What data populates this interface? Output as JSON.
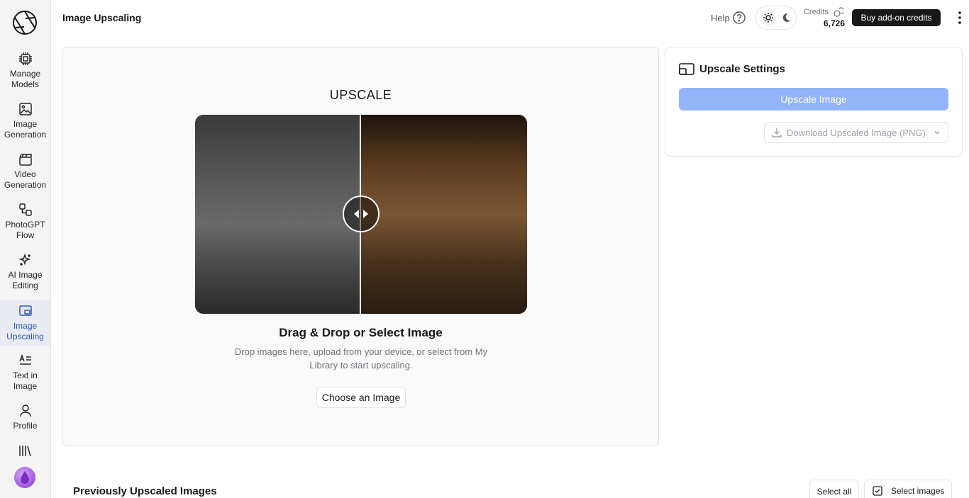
{
  "app": {
    "page_title": "Image Upscaling"
  },
  "sidebar": {
    "items": [
      {
        "label": "Manage Models",
        "icon": "chip-icon"
      },
      {
        "label": "Image Generation",
        "icon": "image-icon"
      },
      {
        "label": "Video Generation",
        "icon": "clapperboard-icon"
      },
      {
        "label": "PhotoGPT Flow",
        "icon": "workflow-icon"
      },
      {
        "label": "AI Image Editing",
        "icon": "sparkles-icon"
      },
      {
        "label": "Image Upscaling",
        "icon": "upscale-icon",
        "active": true
      },
      {
        "label": "Text in Image",
        "icon": "text-icon"
      },
      {
        "label": "Profile",
        "icon": "user-icon"
      }
    ]
  },
  "header": {
    "help_label": "Help",
    "credits_label": "Credits",
    "credits_value": "6,726",
    "buy_label": "Buy add-on credits"
  },
  "upload": {
    "heading": "UPSCALE",
    "dd_title": "Drag & Drop or Select Image",
    "dd_desc": "Drop images here, upload from your device, or select from My Library to start upscaling.",
    "choose_label": "Choose an Image"
  },
  "settings": {
    "title": "Upscale Settings",
    "upscale_label": "Upscale Image",
    "download_label": "Download Upscaled Image (PNG)"
  },
  "previous": {
    "title": "Previously Upscaled Images",
    "select_all_label": "Select all",
    "select_images_label": "Select images"
  },
  "colors": {
    "accent": "#93b4f8",
    "active_nav_bg": "#e8ebf2",
    "active_nav_text": "#2b5bb5",
    "dark_button": "#18181b"
  }
}
